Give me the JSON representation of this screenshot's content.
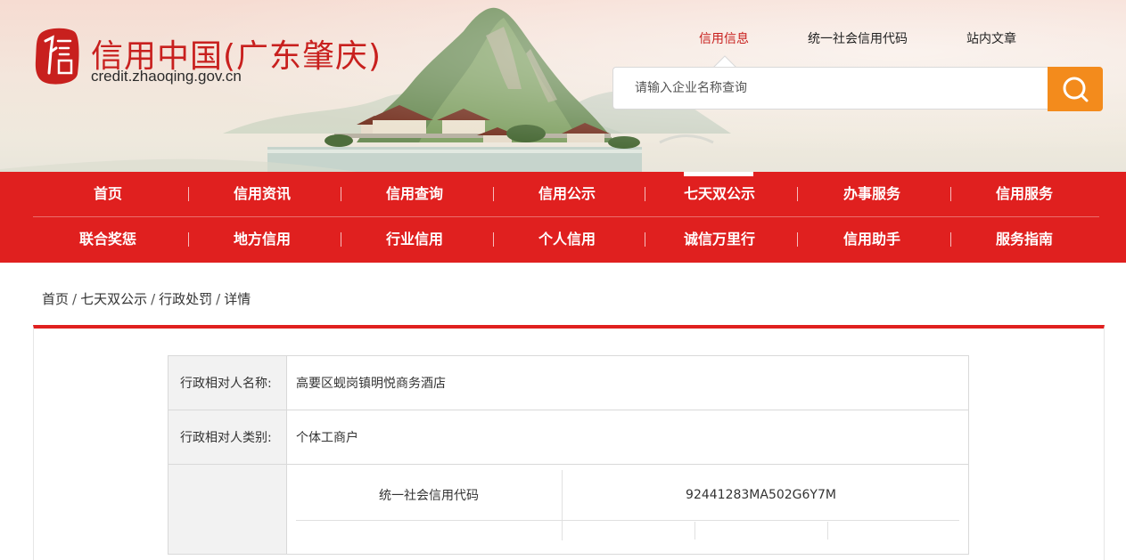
{
  "site": {
    "title": "信用中国(广东肇庆)",
    "url": "credit.zhaoqing.gov.cn",
    "logo_icon": "seal-icon",
    "brand_color": "#e0201f",
    "accent_color": "#f38b1c"
  },
  "topnav": {
    "items": [
      {
        "label": "信用信息",
        "active": true
      },
      {
        "label": "统一社会信用代码",
        "active": false
      },
      {
        "label": "站内文章",
        "active": false
      }
    ]
  },
  "search": {
    "placeholder": "请输入企业名称查询",
    "icon": "search-icon"
  },
  "mainnav": {
    "row1": [
      "首页",
      "信用资讯",
      "信用查询",
      "信用公示",
      "七天双公示",
      "办事服务",
      "信用服务"
    ],
    "row2": [
      "联合奖惩",
      "地方信用",
      "行业信用",
      "个人信用",
      "诚信万里行",
      "信用助手",
      "服务指南"
    ],
    "active": "七天双公示"
  },
  "breadcrumb": [
    "首页",
    "七天双公示",
    "行政处罚",
    "详情"
  ],
  "detail": {
    "rows": [
      {
        "label": "行政相对人名称:",
        "value": "高要区蚬岗镇明悦商务酒店"
      },
      {
        "label": "行政相对人类别:",
        "value": "个体工商户"
      }
    ],
    "code_label": "统一社会信用代码",
    "code_value": "92441283MA502G6Y7M"
  }
}
